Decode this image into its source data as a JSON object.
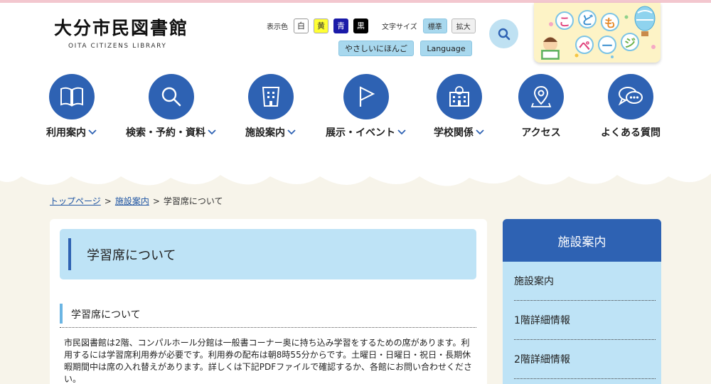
{
  "header": {
    "title": "大分市民図書館",
    "subtitle": "OITA CITIZENS LIBRARY"
  },
  "tools": {
    "color_label": "表示色",
    "colors": [
      {
        "label": "白",
        "color": "#ffffff"
      },
      {
        "label": "黄",
        "color": "#ffff33"
      },
      {
        "label": "青",
        "color": "#1a1aa8"
      },
      {
        "label": "黒",
        "color": "#000000"
      }
    ],
    "size_label": "文字サイズ",
    "size_standard": "標準",
    "size_large": "拡大",
    "easy_japanese": "やさしいにほんご",
    "language": "Language",
    "search_icon": "search-icon"
  },
  "kids_page": {
    "chars": [
      "こ",
      "ど",
      "も",
      "ペ",
      "ー",
      "ジ"
    ]
  },
  "nav": {
    "items": [
      {
        "label": "利用案内",
        "icon": "book-icon",
        "dropdown": true
      },
      {
        "label": "検索・予約・資料",
        "icon": "search-icon",
        "dropdown": true
      },
      {
        "label": "施設案内",
        "icon": "building-icon",
        "dropdown": true
      },
      {
        "label": "展示・イベント",
        "icon": "flag-icon",
        "dropdown": true
      },
      {
        "label": "学校関係",
        "icon": "school-icon",
        "dropdown": true
      },
      {
        "label": "アクセス",
        "icon": "map-pin-icon",
        "dropdown": false
      },
      {
        "label": "よくある質問",
        "icon": "chat-icon",
        "dropdown": false
      }
    ]
  },
  "breadcrumb": {
    "home": "トップページ",
    "parent": "施設案内",
    "current": "学習席について",
    "sep": ">"
  },
  "main": {
    "title": "学習席について",
    "heading": "学習席について",
    "paragraph": "市民図書館は2階、コンパルホール分館は一般書コーナー奥に持ち込み学習をするための席があります。利用するには学習席利用券が必要です。利用券の配布は朝8時55分からです。土曜日・日曜日・祝日・長期休暇期間中は席の入れ替えがあります。詳しくは下記PDFファイルで確認するか、各館にお問い合わせくださ い。"
  },
  "sidebar": {
    "title": "施設案内",
    "items": [
      "施設案内",
      "1階詳細情報",
      "2階詳細情報"
    ]
  },
  "colors": {
    "accent_blue": "#2e62b3",
    "light_blue": "#bee3f6",
    "background": "#f7f4ea"
  }
}
